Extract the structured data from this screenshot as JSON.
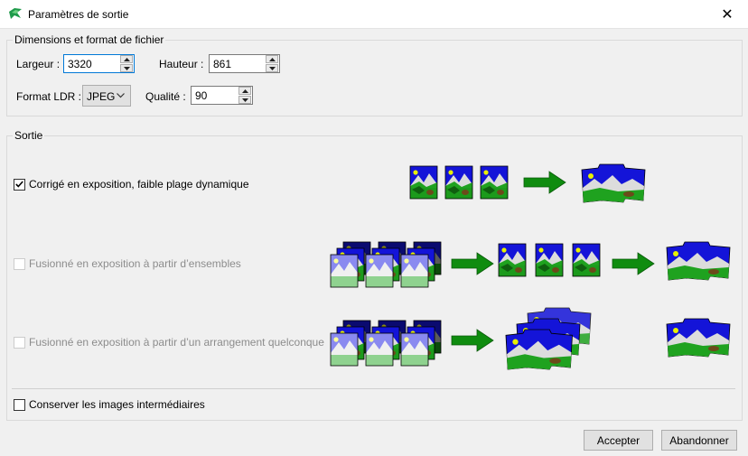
{
  "window": {
    "title": "Paramètres de sortie",
    "app_icon": "hugin-icon",
    "close_glyph": "✕"
  },
  "dimensions": {
    "legend": "Dimensions et format de fichier",
    "width_label": "Largeur :",
    "width_value": "3320",
    "height_label": "Hauteur :",
    "height_value": "861",
    "format_label": "Format LDR :",
    "format_value": "JPEG",
    "quality_label": "Qualité :",
    "quality_value": "90"
  },
  "output": {
    "legend": "Sortie",
    "options": [
      {
        "label": "Corrigé en exposition, faible plage dynamique",
        "checked": true,
        "enabled": true
      },
      {
        "label": "Fusionné en exposition à partir d’ensembles",
        "checked": false,
        "enabled": false
      },
      {
        "label": "Fusionné en exposition à partir d’un arrangement quelconque",
        "checked": false,
        "enabled": false
      }
    ],
    "keep_intermediate": {
      "label": "Conserver les images intermédiaires",
      "checked": false
    }
  },
  "buttons": {
    "accept": "Accepter",
    "cancel": "Abandonner"
  },
  "colors": {
    "sky": "#1414d8",
    "grass": "#1fa21f",
    "arrow": "#0f8c0f",
    "sun": "#e8f000"
  }
}
